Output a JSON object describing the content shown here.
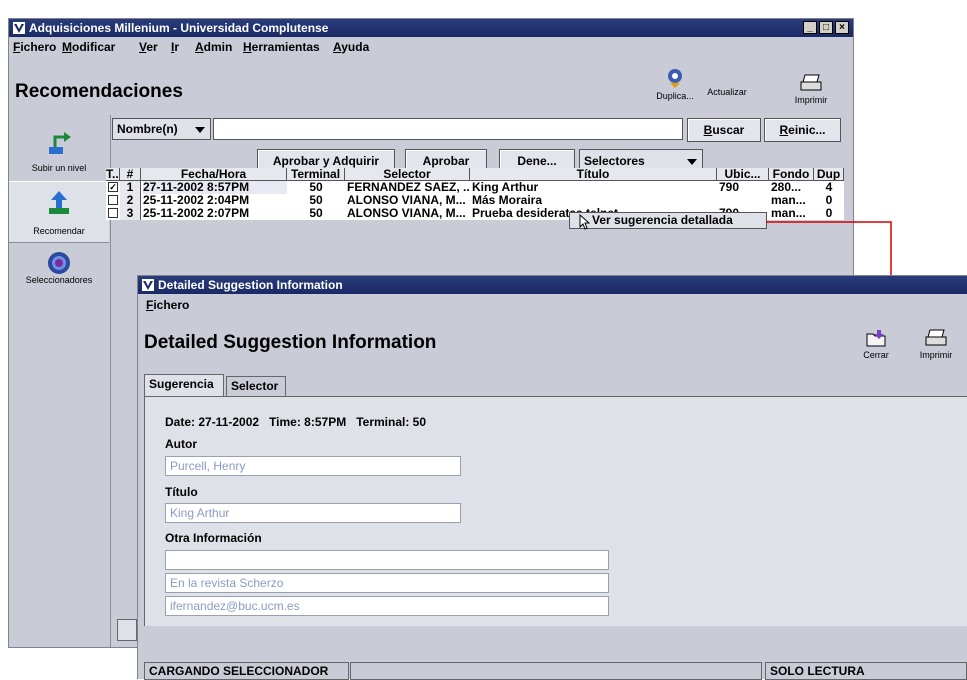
{
  "main_window": {
    "title": "Adquisiciones Millenium - Universidad Complutense",
    "menu": [
      "Fichero",
      "Modificar",
      "Ver",
      "Ir",
      "Admin",
      "Herramientas",
      "Ayuda"
    ],
    "page_title": "Recomendaciones",
    "toolbar": {
      "duplicate_label": "Duplica...",
      "refresh_label": "Actualizar",
      "print_label": "Imprimir"
    },
    "sidebar": [
      {
        "label": "Subir un nivel",
        "icon": "up-level-icon"
      },
      {
        "label": "Recomendar",
        "icon": "recommend-icon"
      },
      {
        "label": "Seleccionadores",
        "icon": "selectors-icon"
      }
    ],
    "search": {
      "field_selector": "Nombre(n)",
      "value": "",
      "search_label": "Buscar",
      "reset_label": "Reinic..."
    },
    "actions": {
      "approve_acquire": "Aprobar y Adquirir",
      "approve": "Aprobar",
      "deny": "Dene...",
      "selectors": "Selectores"
    },
    "table": {
      "columns": [
        "T...",
        "#",
        "Fecha/Hora",
        "Terminal",
        "Selector",
        "Título",
        "Ubic...",
        "Fondo",
        "Dup"
      ],
      "rows": [
        {
          "checked": true,
          "num": "1",
          "datetime": "27-11-2002 8:57PM",
          "terminal": "50",
          "selector": "FERNANDEZ SAEZ, ...",
          "title": "King Arthur",
          "location": "790",
          "fund": "280...",
          "dup": "4"
        },
        {
          "checked": false,
          "num": "2",
          "datetime": "25-11-2002 2:04PM",
          "terminal": "50",
          "selector": "ALONSO VIANA, M...",
          "title": "Más Moraira",
          "location": "",
          "fund": "man...",
          "dup": "0"
        },
        {
          "checked": false,
          "num": "3",
          "datetime": "25-11-2002 2:07PM",
          "terminal": "50",
          "selector": "ALONSO VIANA, M...",
          "title": "Prueba desideratas telnet",
          "location": "790",
          "fund": "man...",
          "dup": "0"
        }
      ]
    },
    "context_menu": {
      "item": "Ver sugerencia detallada"
    }
  },
  "dialog": {
    "title": "Detailed Suggestion Information",
    "menu": [
      "Fichero"
    ],
    "heading": "Detailed Suggestion Information",
    "toolbar": {
      "close_label": "Cerrar",
      "print_label": "Imprimir"
    },
    "tabs": [
      "Sugerencia",
      "Selector"
    ],
    "info_line": "Date: 27-11-2002   Time: 8:57PM   Terminal: 50",
    "author_label": "Autor",
    "author_value": "Purcell, Henry",
    "title_label": "Título",
    "title_value": "King Arthur",
    "other_label": "Otra Información",
    "other_values": [
      "",
      "En la revista Scherzo",
      "ifernandez@buc.ucm.es"
    ],
    "status": {
      "left": "CARGANDO SELECCIONADOR",
      "middle": "",
      "right": "SOLO LECTURA"
    }
  },
  "colors": {
    "title_bar": "#1a2a66",
    "connector_line": "#d40000",
    "placeholder_text": "#8a9bc8"
  }
}
